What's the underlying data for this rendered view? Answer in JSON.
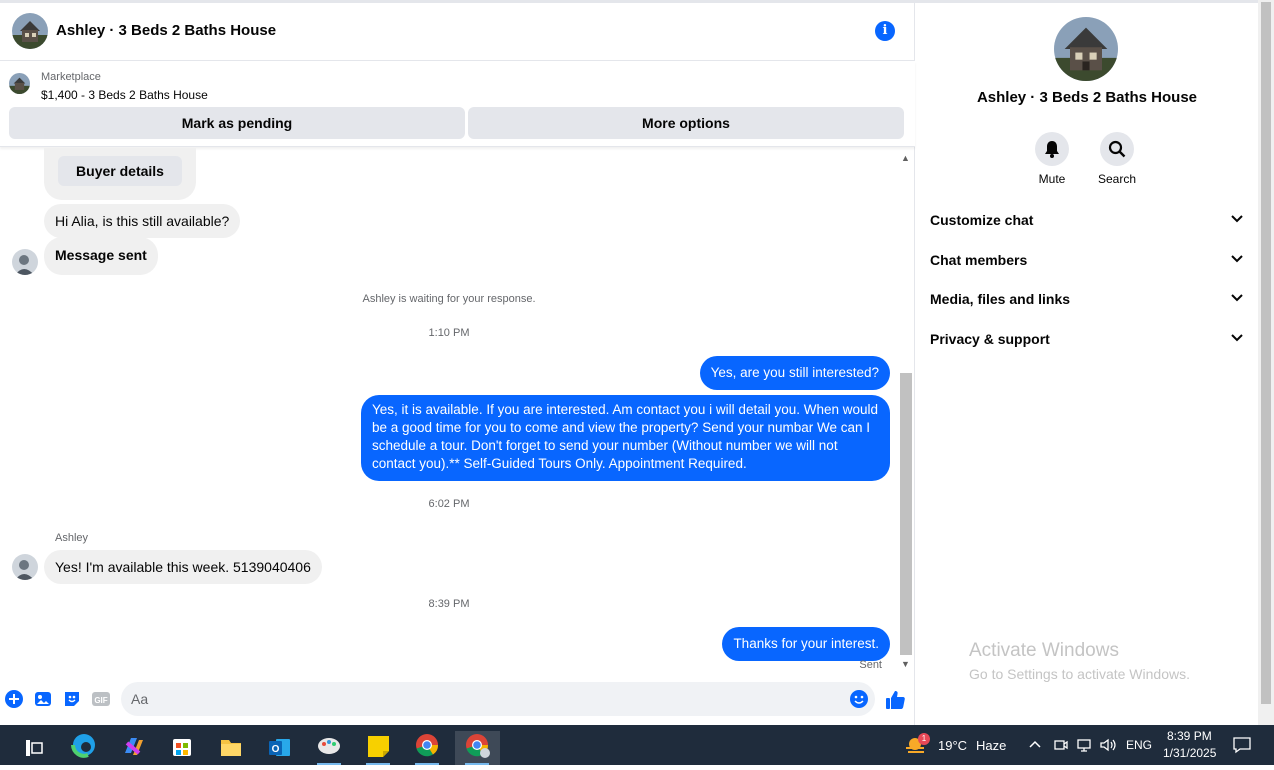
{
  "chat": {
    "title": "Ashley · 3 Beds 2 Baths House",
    "marketplace_label": "Marketplace",
    "listing": "$1,400 - 3 Beds 2 Baths House",
    "mark_pending": "Mark as pending",
    "more_options": "More options",
    "buyer_details": "Buyer details",
    "messages": {
      "m1": "Hi Alia, is this still available?",
      "m2": "Message sent",
      "waiting": "Ashley is waiting for your response.",
      "time1": "1:10 PM",
      "m3": "Yes, are you still interested?",
      "m4": "Yes, it is available. If you are interested.  Am contact you i will detail you.  When would be a good time for you to come and view the property? Send your numbar We can I schedule a tour.  Don't forget to send your number (Without number we will not contact you).** Self-Guided Tours Only. Appointment Required.",
      "time2": "6:02 PM",
      "sender": "Ashley",
      "m5": "Yes! I'm available this week. 5139040406",
      "time3": "8:39 PM",
      "m6": "Thanks for your interest.",
      "status": "Sent"
    },
    "composer_placeholder": "Aa"
  },
  "panel": {
    "title": "Ashley · 3 Beds 2 Baths House",
    "mute": "Mute",
    "search": "Search",
    "rows": [
      "Customize chat",
      "Chat members",
      "Media, files and links",
      "Privacy & support"
    ],
    "watermark_title": "Activate Windows",
    "watermark_sub": "Go to Settings to activate Windows."
  },
  "taskbar": {
    "weather_temp": "19°C",
    "weather_cond": "Haze",
    "weather_badge": "1",
    "lang": "ENG",
    "time": "8:39 PM",
    "date": "1/31/2025"
  },
  "colors": {
    "accent": "#0866ff",
    "bubble_in": "#f0f0f0",
    "taskbar": "#1f2c3c"
  }
}
